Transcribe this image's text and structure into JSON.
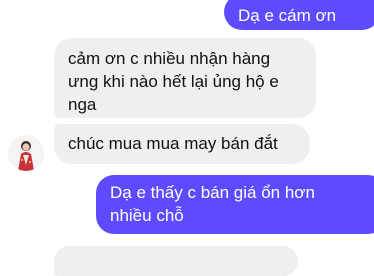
{
  "messages": [
    {
      "side": "outgoing",
      "lines": [
        "Dạ e cám ơn"
      ]
    },
    {
      "side": "incoming",
      "lines": [
        "cảm ơn c nhiều nhận hàng",
        "ưng khi nào hết lại ủng hộ e",
        "nga"
      ]
    },
    {
      "side": "incoming",
      "lines": [
        "chúc mua mua may bán đắt"
      ]
    },
    {
      "side": "outgoing",
      "lines": [
        "Dạ e thấy c bán giá ổn hơn",
        "nhiều chỗ"
      ]
    },
    {
      "side": "incoming",
      "lines": [
        ""
      ]
    }
  ],
  "colors": {
    "outgoing_bubble": "#5f4bff",
    "incoming_bubble": "#efeff2"
  },
  "avatar": {
    "icon": "contact-avatar"
  }
}
